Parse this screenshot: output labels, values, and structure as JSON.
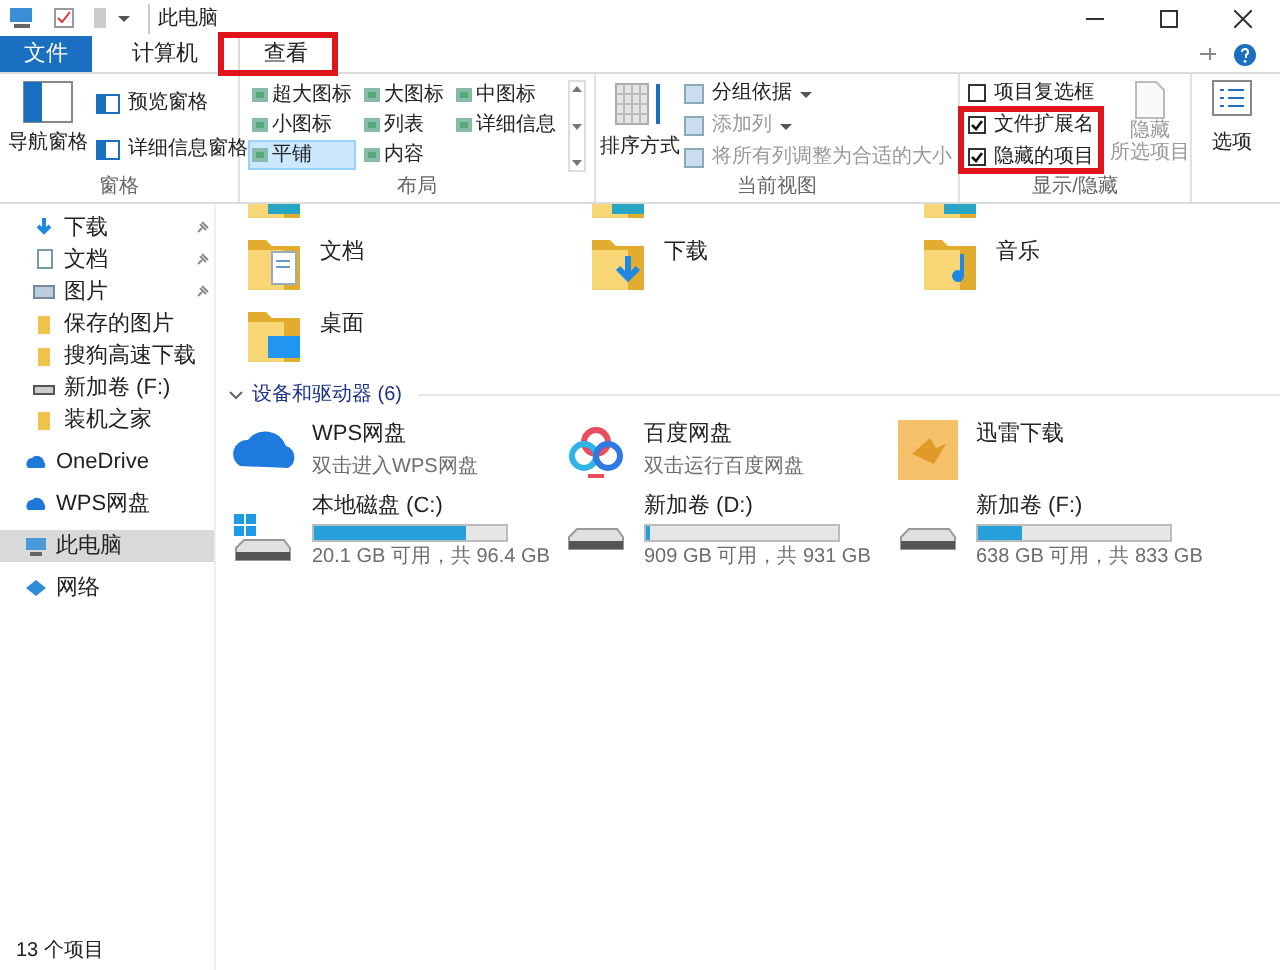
{
  "window": {
    "title": "此电脑"
  },
  "tabs": [
    {
      "label": "文件",
      "kind": "file",
      "selected": false,
      "highlighted": false
    },
    {
      "label": "计算机",
      "kind": "tab",
      "selected": false,
      "highlighted": false
    },
    {
      "label": "查看",
      "kind": "tab",
      "selected": true,
      "highlighted": true
    }
  ],
  "ribbon": {
    "pane": {
      "label": "窗格",
      "nav": "导航窗格",
      "items": [
        "预览窗格",
        "详细信息窗格"
      ]
    },
    "layout": {
      "label": "布局",
      "items": [
        {
          "label": "超大图标",
          "selected": false
        },
        {
          "label": "大图标",
          "selected": false
        },
        {
          "label": "中图标",
          "selected": false
        },
        {
          "label": "小图标",
          "selected": false
        },
        {
          "label": "列表",
          "selected": false
        },
        {
          "label": "详细信息",
          "selected": false
        },
        {
          "label": "平铺",
          "selected": true
        },
        {
          "label": "内容",
          "selected": false
        }
      ]
    },
    "current_view": {
      "label": "当前视图",
      "sort": "排序方式",
      "items": [
        {
          "label": "分组依据",
          "disabled": false,
          "menu": true
        },
        {
          "label": "添加列",
          "disabled": true,
          "menu": true
        },
        {
          "label": "将所有列调整为合适的大小",
          "disabled": true,
          "menu": false
        }
      ]
    },
    "show_hide": {
      "label": "显示/隐藏",
      "checkboxes": [
        {
          "label": "项目复选框",
          "checked": false,
          "highlighted": false
        },
        {
          "label": "文件扩展名",
          "checked": true,
          "highlighted": true
        },
        {
          "label": "隐藏的项目",
          "checked": true,
          "highlighted": true
        }
      ],
      "hide_button": {
        "lines": [
          "隐藏",
          "所选项目"
        ],
        "disabled": true
      }
    },
    "options": {
      "label": "选项"
    }
  },
  "sidebar": {
    "items": [
      {
        "label": "下载",
        "kind": "download",
        "pinned": true,
        "selected": false
      },
      {
        "label": "文档",
        "kind": "doc",
        "pinned": true,
        "selected": false
      },
      {
        "label": "图片",
        "kind": "pic",
        "pinned": true,
        "selected": false
      },
      {
        "label": "保存的图片",
        "kind": "folder",
        "pinned": false,
        "selected": false
      },
      {
        "label": "搜狗高速下载",
        "kind": "folder",
        "pinned": false,
        "selected": false
      },
      {
        "label": "新加卷 (F:)",
        "kind": "drive",
        "pinned": false,
        "selected": false
      },
      {
        "label": "装机之家",
        "kind": "folder",
        "pinned": false,
        "selected": false
      },
      {
        "label": "OneDrive",
        "kind": "cloud",
        "pinned": false,
        "selected": false
      },
      {
        "label": "WPS网盘",
        "kind": "cloud",
        "pinned": false,
        "selected": false
      },
      {
        "label": "此电脑",
        "kind": "pc",
        "pinned": false,
        "selected": true
      },
      {
        "label": "网络",
        "kind": "net",
        "pinned": false,
        "selected": false
      }
    ]
  },
  "folders": [
    {
      "label": "文档",
      "kind": "doc"
    },
    {
      "label": "下载",
      "kind": "download"
    },
    {
      "label": "音乐",
      "kind": "music"
    },
    {
      "label": "桌面",
      "kind": "desktop"
    }
  ],
  "devices": {
    "header": "设备和驱动器 (6)",
    "apps": [
      {
        "name": "WPS网盘",
        "note": "双击进入WPS网盘",
        "kind": "wps"
      },
      {
        "name": "百度网盘",
        "note": "双击运行百度网盘",
        "kind": "baidu"
      },
      {
        "name": "迅雷下载",
        "kind": "xunlei"
      }
    ],
    "drives": [
      {
        "name": "本地磁盘 (C:)",
        "level": 0.79,
        "space": "20.1 GB 可用，共 96.4 GB",
        "system": true
      },
      {
        "name": "新加卷 (D:)",
        "level": 0.02,
        "space": "909 GB 可用，共 931 GB",
        "system": false
      },
      {
        "name": "新加卷 (F:)",
        "level": 0.23,
        "space": "638 GB 可用，共 833 GB",
        "system": false
      }
    ]
  },
  "status_bar": "13 个项目"
}
